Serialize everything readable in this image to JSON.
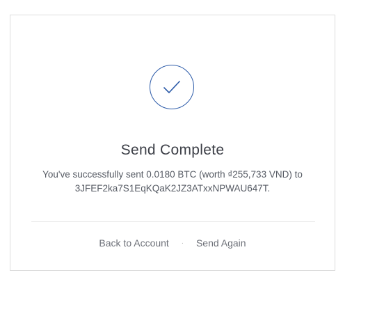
{
  "dialog": {
    "icon": "checkmark-circle-icon",
    "title": "Send Complete",
    "message_line1": "You've successfully sent 0.0180 BTC (worth ₫255,733 VND) to",
    "message_line2": "3JFEF2ka7S1EqKQaK2JZ3ATxxNPWAU647T.",
    "actions": {
      "back_label": "Back to Account",
      "separator": "·",
      "send_again_label": "Send Again"
    }
  },
  "colors": {
    "accent": "#2b5aa8",
    "title_text": "#3c3f47",
    "body_text": "#555a63",
    "link_text": "#6d7078",
    "border": "#dcdcdc"
  }
}
